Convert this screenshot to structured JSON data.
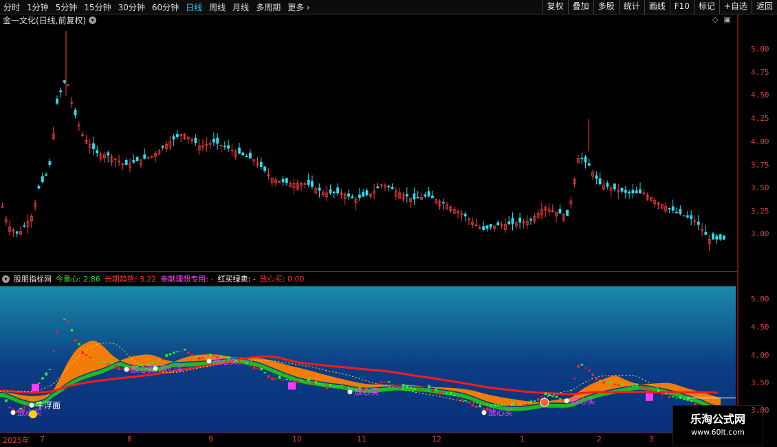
{
  "toolbar": {
    "periods": [
      "分时",
      "1分钟",
      "5分钟",
      "15分钟",
      "30分钟",
      "60分钟",
      "日线",
      "周线",
      "月线",
      "多周期",
      "更多"
    ],
    "active_period": "日线",
    "right_buttons": [
      "复权",
      "叠加",
      "多股",
      "统计",
      "画线",
      "F10",
      "标记",
      "+自选",
      "返回"
    ]
  },
  "stock_title": "金一文化(日线,前复权)",
  "main_axis": [
    "5.00",
    "4.75",
    "4.50",
    "4.25",
    "4.00",
    "3.75",
    "3.50",
    "3.25",
    "3.00"
  ],
  "indicator": {
    "name": "股朋指标网",
    "items": [
      {
        "label": "今重心:",
        "value": "2.86",
        "color": "#30e030"
      },
      {
        "label": "长期趋势:",
        "value": "3.22",
        "color": "#ff3030"
      },
      {
        "label": "奉献理想专用:",
        "value": "-",
        "color": "#ff40ff"
      },
      {
        "label": "红买绿卖:",
        "value": "-",
        "color": "#ffffff"
      },
      {
        "label": "放心买:",
        "value": "0.00",
        "color": "#ff3030"
      }
    ],
    "axis": [
      "5.00",
      "4.50",
      "4.00",
      "3.50",
      "3.00"
    ],
    "annotations": [
      "牛浮面",
      "放心买",
      "放心买",
      "放心买",
      "放心买",
      "放心买",
      "放心买",
      "放心买"
    ]
  },
  "dates": [
    "2025年",
    "7",
    "8",
    "9",
    "10",
    "11",
    "12",
    "1",
    "2",
    "3"
  ],
  "watermark": {
    "line1": "乐淘公式网",
    "line2": "www.60lt.com"
  },
  "colors": {
    "up": "#ff3b3b",
    "down": "#27e0f0",
    "ma_green": "#1fc21f",
    "ma_orange": "#ff7f00",
    "trend_red": "#ff1a1a"
  }
}
